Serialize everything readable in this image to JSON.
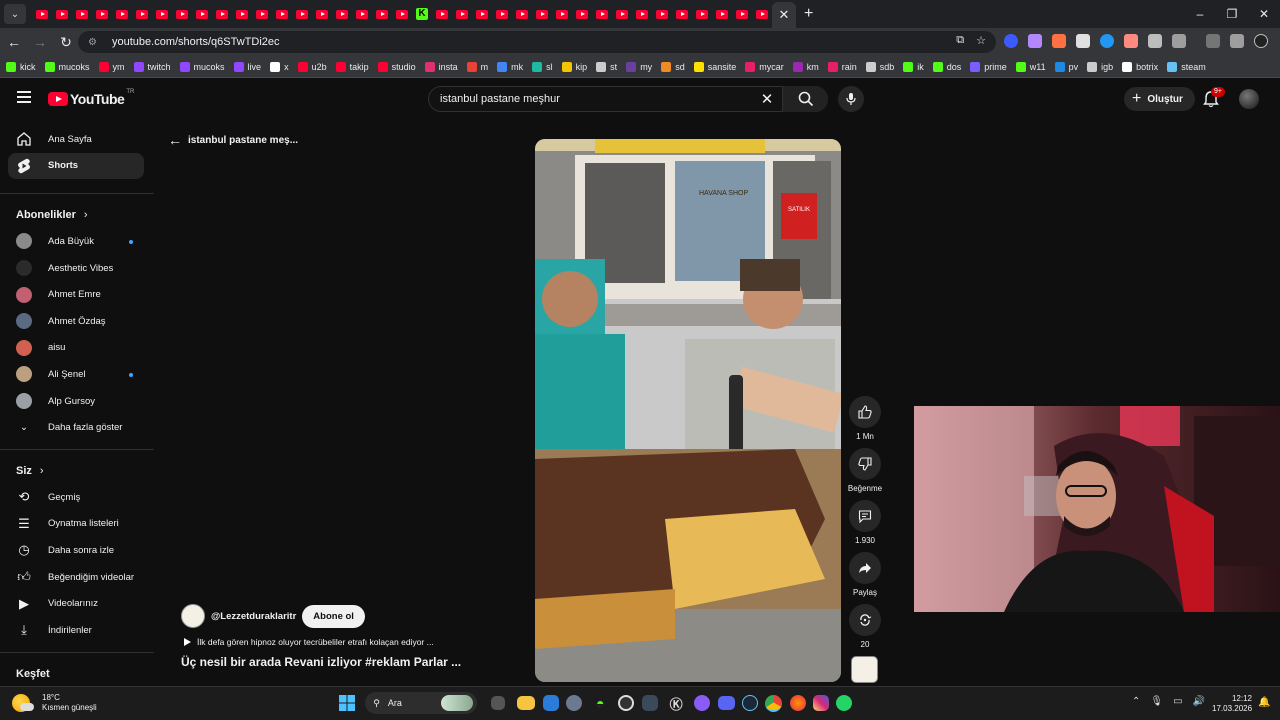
{
  "browser": {
    "url": "youtube.com/shorts/q6STwTDi2ec",
    "new_tab_symbol": "+",
    "close_tab_symbol": "✕",
    "window_controls": [
      "–",
      "❐",
      "✕"
    ]
  },
  "bookmarks": [
    {
      "label": "kick",
      "color": "#53fc18"
    },
    {
      "label": "mucoks",
      "color": "#53fc18"
    },
    {
      "label": "ym",
      "color": "#ff0033"
    },
    {
      "label": "twitch",
      "color": "#9146ff"
    },
    {
      "label": "mucoks",
      "color": "#9146ff"
    },
    {
      "label": "live",
      "color": "#9146ff"
    },
    {
      "label": "x",
      "color": "#ffffff"
    },
    {
      "label": "u2b",
      "color": "#ff0033"
    },
    {
      "label": "takip",
      "color": "#ff0033"
    },
    {
      "label": "studio",
      "color": "#ff0033"
    },
    {
      "label": "insta",
      "color": "#e1306c"
    },
    {
      "label": "m",
      "color": "#ea4335"
    },
    {
      "label": "mk",
      "color": "#4285f4"
    },
    {
      "label": "sl",
      "color": "#1fb8a0"
    },
    {
      "label": "kip",
      "color": "#f5c400"
    },
    {
      "label": "st",
      "color": "#cccccc"
    },
    {
      "label": "my",
      "color": "#6b3fa0"
    },
    {
      "label": "sd",
      "color": "#f08a24"
    },
    {
      "label": "sansite",
      "color": "#ffe000"
    },
    {
      "label": "mycar",
      "color": "#e91e63"
    },
    {
      "label": "km",
      "color": "#9c27b0"
    },
    {
      "label": "rain",
      "color": "#e91e63"
    },
    {
      "label": "sdb",
      "color": "#cccccc"
    },
    {
      "label": "ik",
      "color": "#53fc18"
    },
    {
      "label": "dos",
      "color": "#53fc18"
    },
    {
      "label": "prime",
      "color": "#7b5cff"
    },
    {
      "label": "w11",
      "color": "#53fc18"
    },
    {
      "label": "pv",
      "color": "#1e88e5"
    },
    {
      "label": "igb",
      "color": "#cccccc"
    },
    {
      "label": "botrix",
      "color": "#ffffff"
    },
    {
      "label": "steam",
      "color": "#66c0f4"
    }
  ],
  "header": {
    "logo_text": "YouTube",
    "logo_region": "TR",
    "search_query": "istanbul pastane meşhur",
    "create_label": "Oluştur",
    "notification_count": "9+"
  },
  "sidebar": {
    "main": [
      {
        "label": "Ana Sayfa",
        "icon": "home-icon"
      },
      {
        "label": "Shorts",
        "icon": "shorts-icon"
      }
    ],
    "subscriptions_heading": "Abonelikler",
    "subscriptions": [
      {
        "label": "Ada Büyük",
        "color": "#8a8a8a",
        "new": true
      },
      {
        "label": "Aesthetic Vibes",
        "color": "#2b2b2b",
        "new": false
      },
      {
        "label": "Ahmet Emre",
        "color": "#c06070",
        "new": false
      },
      {
        "label": "Ahmet Özdaş",
        "color": "#5a6a80",
        "new": false
      },
      {
        "label": "aisu",
        "color": "#d06050",
        "new": false
      },
      {
        "label": "Ali Şenel",
        "color": "#bba080",
        "new": true
      },
      {
        "label": "Alp Gursoy",
        "color": "#9aa0a6",
        "new": false
      }
    ],
    "show_more_label": "Daha fazla göster",
    "you_heading": "Siz",
    "you_items": [
      {
        "label": "Geçmiş",
        "icon": "history-icon"
      },
      {
        "label": "Oynatma listeleri",
        "icon": "playlist-icon"
      },
      {
        "label": "Daha sonra izle",
        "icon": "clock-icon"
      },
      {
        "label": "Beğendiğim videolar",
        "icon": "thumbs-up-icon"
      },
      {
        "label": "Videolarınız",
        "icon": "video-icon"
      },
      {
        "label": "İndirilenler",
        "icon": "download-icon"
      }
    ],
    "explore_heading": "Keşfet"
  },
  "shorts": {
    "back_label": "istanbul pastane meş...",
    "channel_handle": "@Lezzetduraklaritr",
    "subscribe_label": "Abone ol",
    "description": "İlk defa gören hipnoz oluyor tecrübeliler etrafı kolaçan ediyor ...",
    "title": "Üç nesil bir arada Revani izliyor #reklam Parlar ...",
    "likes": "1 Mn",
    "dislike_label": "Beğenme",
    "comments": "1.930",
    "share_label": "Paylaş",
    "remix_count": "20",
    "shop_sign": "HAVANA SHOP",
    "sale_sign": "SATILIK DÜKKAN & DEPO"
  },
  "taskbar": {
    "temperature": "18°C",
    "weather": "Kısmen güneşli",
    "search_placeholder": "Ara",
    "time": "12:12",
    "date": "17.03.2026"
  }
}
